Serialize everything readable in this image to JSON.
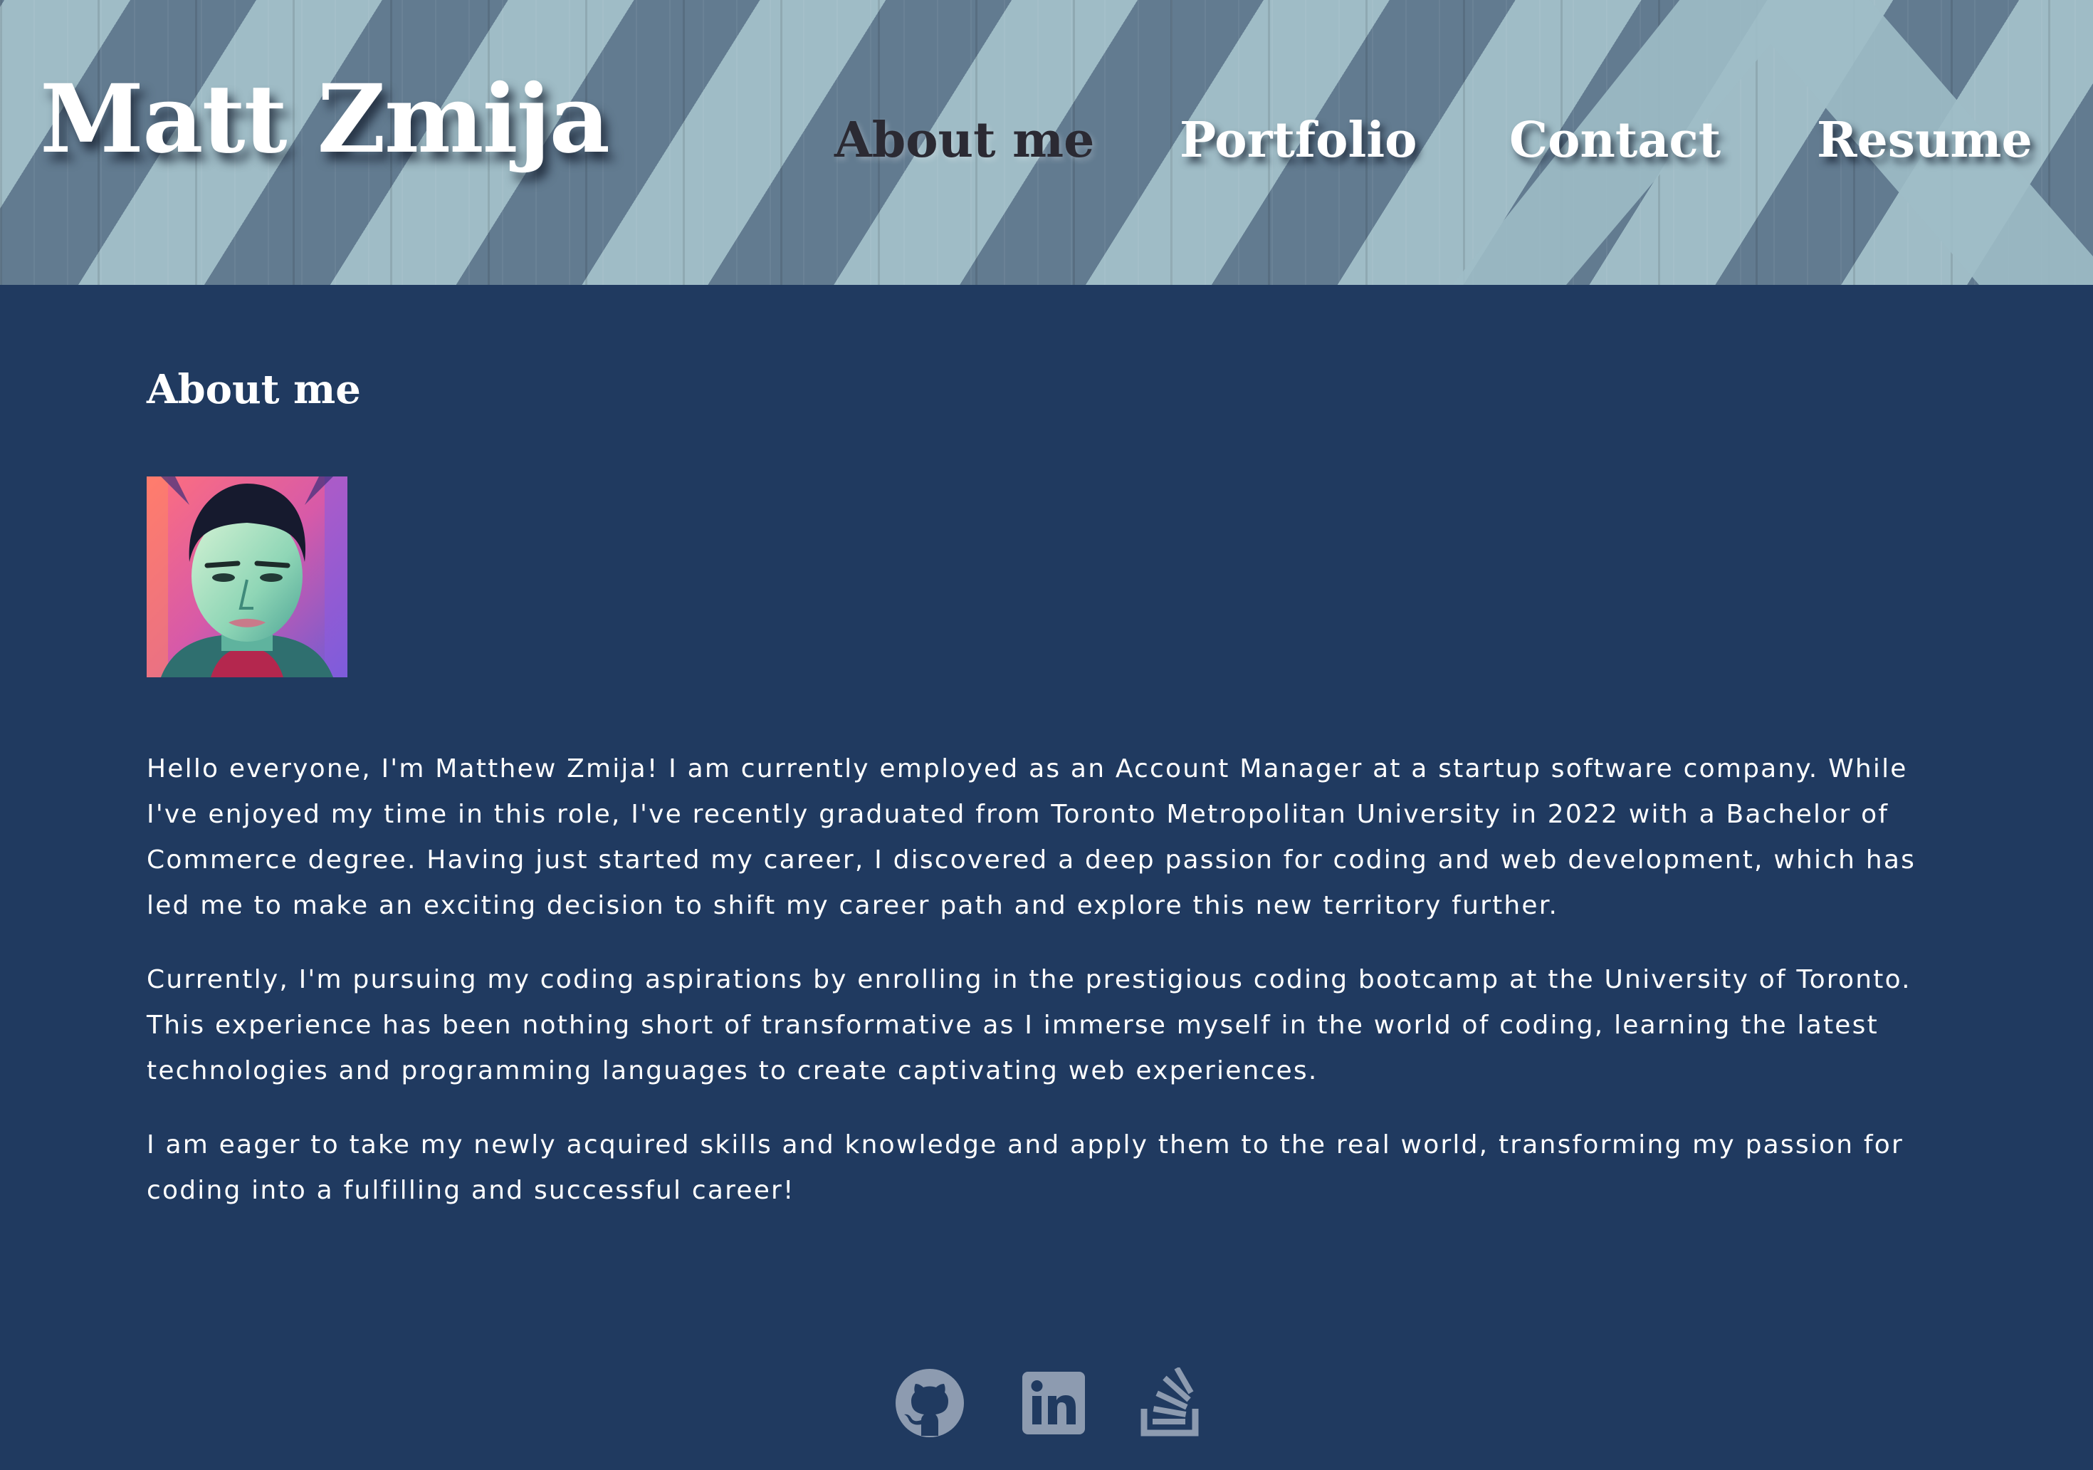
{
  "header": {
    "site_title": "Matt Zmija",
    "nav": [
      {
        "label": "About me",
        "active": true
      },
      {
        "label": "Portfolio",
        "active": false
      },
      {
        "label": "Contact",
        "active": false
      },
      {
        "label": "Resume",
        "active": false
      }
    ]
  },
  "main": {
    "heading": "About me",
    "avatar_icon": "portrait-illustration",
    "paragraphs": [
      "Hello everyone, I'm Matthew Zmija! I am currently employed as an Account Manager at a startup software company. While I've enjoyed my time in this role, I've recently graduated from Toronto Metropolitan University in 2022 with a Bachelor of Commerce degree. Having just started my career, I discovered a deep passion for coding and web development, which has led me to make an exciting decision to shift my career path and explore this new territory further.",
      "Currently, I'm pursuing my coding aspirations by enrolling in the prestigious coding bootcamp at the University of Toronto. This experience has been nothing short of transformative as I immerse myself in the world of coding, learning the latest technologies and programming languages to create captivating web experiences.",
      "I am eager to take my newly acquired skills and knowledge and apply them to the real world, transforming my passion for coding into a fulfilling and successful career!"
    ]
  },
  "footer": {
    "social_icons": [
      "github-icon",
      "linkedin-icon",
      "stack-overflow-icon"
    ]
  },
  "colors": {
    "page_background": "#203a60",
    "header_stripe_dark": "#627b90",
    "header_stripe_light": "#9fbcc6",
    "text": "#ffffff",
    "active_nav": "#2b2a33",
    "footer_icon": "#8d9bb0"
  }
}
